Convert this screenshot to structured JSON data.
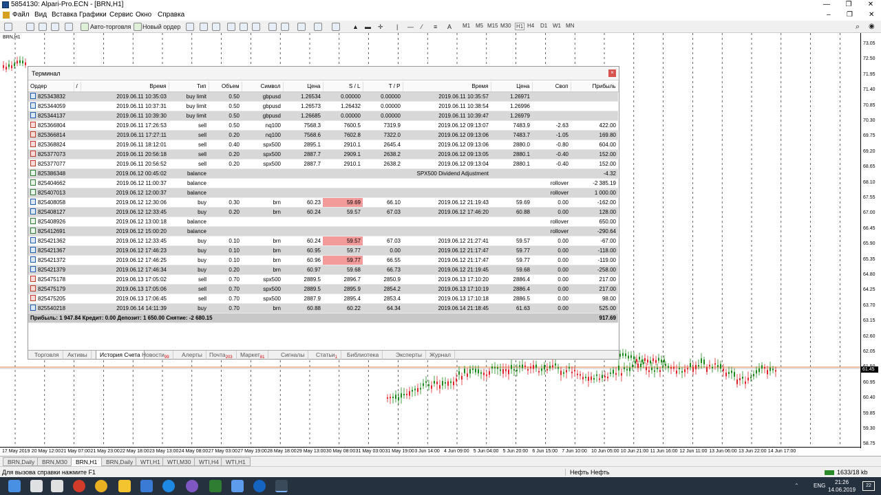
{
  "window": {
    "title": "5854130: Alpari-Pro.ECN - [BRN,H1]"
  },
  "menu": [
    "Файл",
    "Вид",
    "Вставка",
    "Графики",
    "Сервис",
    "Окно",
    "Справка"
  ],
  "toolbar": {
    "auto_trading": "Авто-торговля",
    "new_order": "Новый ордер",
    "timeframes": [
      "M1",
      "M5",
      "M15",
      "M30",
      "H1",
      "H4",
      "D1",
      "W1",
      "MN"
    ]
  },
  "chart": {
    "symbol_label": "BRN,H1",
    "current_price": "61.45",
    "price_labels": [
      "73.05",
      "72.50",
      "71.95",
      "71.40",
      "70.85",
      "70.30",
      "69.75",
      "69.20",
      "68.65",
      "68.10",
      "67.55",
      "67.00",
      "66.45",
      "65.90",
      "65.35",
      "64.80",
      "64.25",
      "63.70",
      "63.15",
      "62.60",
      "62.05",
      "61.50",
      "60.95",
      "60.40",
      "59.85",
      "59.30",
      "58.75"
    ],
    "time_labels": [
      "17 May 2019",
      "20 May 12:00",
      "21 May 07:00",
      "21 May 23:00",
      "22 May 18:00",
      "23 May 13:00",
      "24 May 08:00",
      "27 May 03:00",
      "27 May 19:00",
      "28 May 18:00",
      "29 May 13:00",
      "30 May 08:00",
      "31 May 03:00",
      "31 May 19:00",
      "3 Jun 14:00",
      "4 Jun 09:00",
      "5 Jun 04:00",
      "5 Jun 20:00",
      "6 Jun 15:00",
      "7 Jun 10:00",
      "10 Jun 05:00",
      "10 Jun 21:00",
      "11 Jun 16:00",
      "12 Jun 11:00",
      "13 Jun 06:00",
      "13 Jun 22:00",
      "14 Jun 17:00"
    ]
  },
  "chart_tabs": [
    "BRN,Daily",
    "BRN,M30",
    "BRN,H1",
    "BRN,Daily",
    "WTI,H1",
    "WTI,M30",
    "WTI,H4",
    "WTI,H1"
  ],
  "active_chart_tab": 2,
  "terminal": {
    "title": "Терминал",
    "columns": [
      "Ордер",
      "/",
      "Время",
      "Тип",
      "Объем",
      "Символ",
      "Цена",
      "S / L",
      "T / P",
      "Время",
      "Цена",
      "Своп",
      "Прибыль"
    ],
    "rows": [
      {
        "k": "buy",
        "c": [
          "825343832",
          "2019.06.11 10:35:03",
          "buy limit",
          "0.50",
          "gbpusd",
          "1.26534",
          "0.00000",
          "0.00000",
          "2019.06.11 10:35:57",
          "1.26971",
          "",
          ""
        ]
      },
      {
        "k": "buy",
        "c": [
          "825344059",
          "2019.06.11 10:37:31",
          "buy limit",
          "0.50",
          "gbpusd",
          "1.26573",
          "1.26432",
          "0.00000",
          "2019.06.11 10:38:54",
          "1.26996",
          "",
          ""
        ]
      },
      {
        "k": "buy",
        "c": [
          "825344137",
          "2019.06.11 10:39:30",
          "buy limit",
          "0.50",
          "gbpusd",
          "1.26685",
          "0.00000",
          "0.00000",
          "2019.06.11 10:39:47",
          "1.26979",
          "",
          ""
        ]
      },
      {
        "k": "sell",
        "c": [
          "825366804",
          "2019.06.11 17:26:53",
          "sell",
          "0.50",
          "nq100",
          "7568.3",
          "7600.5",
          "7319.9",
          "2019.06.12 09:13:07",
          "7483.9",
          "-2.63",
          "422.00"
        ]
      },
      {
        "k": "sell",
        "c": [
          "825366814",
          "2019.06.11 17:27:11",
          "sell",
          "0.20",
          "nq100",
          "7568.6",
          "7602.8",
          "7322.0",
          "2019.06.12 09:13:06",
          "7483.7",
          "-1.05",
          "169.80"
        ]
      },
      {
        "k": "sell",
        "c": [
          "825368824",
          "2019.06.11 18:12:01",
          "sell",
          "0.40",
          "spx500",
          "2895.1",
          "2910.1",
          "2645.4",
          "2019.06.12 09:13:06",
          "2880.0",
          "-0.80",
          "604.00"
        ]
      },
      {
        "k": "sell",
        "c": [
          "825377073",
          "2019.06.11 20:56:18",
          "sell",
          "0.20",
          "spx500",
          "2887.7",
          "2909.1",
          "2638.2",
          "2019.06.12 09:13:05",
          "2880.1",
          "-0.40",
          "152.00"
        ]
      },
      {
        "k": "sell",
        "c": [
          "825377077",
          "2019.06.11 20:56:52",
          "sell",
          "0.20",
          "spx500",
          "2887.7",
          "2910.1",
          "2638.2",
          "2019.06.12 09:13:04",
          "2880.1",
          "-0.40",
          "152.00"
        ]
      },
      {
        "k": "bal",
        "c": [
          "825386348",
          "2019.06.12 00:45:02",
          "balance",
          "",
          "",
          "",
          "",
          "",
          "SPX500 Dividend Adjustment",
          "",
          "",
          "-4.32"
        ]
      },
      {
        "k": "bal",
        "c": [
          "825404662",
          "2019.06.12 11:00:37",
          "balance",
          "",
          "",
          "",
          "",
          "",
          "",
          "",
          "rollover",
          "-2 385.19"
        ]
      },
      {
        "k": "bal",
        "c": [
          "825407013",
          "2019.06.12 12:00:37",
          "balance",
          "",
          "",
          "",
          "",
          "",
          "",
          "",
          "rollover",
          "1 000.00"
        ]
      },
      {
        "k": "buy",
        "hl": true,
        "c": [
          "825408058",
          "2019.06.12 12:30:06",
          "buy",
          "0.30",
          "brn",
          "60.23",
          "59.69",
          "66.10",
          "2019.06.12 21:19:43",
          "59.69",
          "0.00",
          "-162.00"
        ]
      },
      {
        "k": "buy",
        "c": [
          "825408127",
          "2019.06.12 12:33:45",
          "buy",
          "0.20",
          "brn",
          "60.24",
          "59.57",
          "67.03",
          "2019.06.12 17:46:20",
          "60.88",
          "0.00",
          "128.00"
        ]
      },
      {
        "k": "bal",
        "c": [
          "825408926",
          "2019.06.12 13:00:18",
          "balance",
          "",
          "",
          "",
          "",
          "",
          "",
          "",
          "rollover",
          "650.00"
        ]
      },
      {
        "k": "bal",
        "c": [
          "825412691",
          "2019.06.12 15:00:20",
          "balance",
          "",
          "",
          "",
          "",
          "",
          "",
          "",
          "rollover",
          "-290.64"
        ]
      },
      {
        "k": "buy",
        "hl": true,
        "c": [
          "825421362",
          "2019.06.12 12:33:45",
          "buy",
          "0.10",
          "brn",
          "60.24",
          "59.57",
          "67.03",
          "2019.06.12 21:27:41",
          "59.57",
          "0.00",
          "-67.00"
        ]
      },
      {
        "k": "buy",
        "hl": true,
        "c": [
          "825421367",
          "2019.06.12 17:46:23",
          "buy",
          "0.10",
          "brn",
          "60.95",
          "59.77",
          "0.00",
          "2019.06.12 21:17:47",
          "59.77",
          "0.00",
          "-118.00"
        ]
      },
      {
        "k": "buy",
        "hl": true,
        "c": [
          "825421372",
          "2019.06.12 17:46:25",
          "buy",
          "0.10",
          "brn",
          "60.96",
          "59.77",
          "66.55",
          "2019.06.12 21:17:47",
          "59.77",
          "0.00",
          "-119.00"
        ]
      },
      {
        "k": "buy",
        "hl": true,
        "c": [
          "825421379",
          "2019.06.12 17:46:34",
          "buy",
          "0.20",
          "brn",
          "60.97",
          "59.68",
          "66.73",
          "2019.06.12 21:19:45",
          "59.68",
          "0.00",
          "-258.00"
        ]
      },
      {
        "k": "sell",
        "c": [
          "825475178",
          "2019.06.13 17:05:02",
          "sell",
          "0.70",
          "spx500",
          "2889.5",
          "2896.7",
          "2850.9",
          "2019.06.13 17:10:20",
          "2886.4",
          "0.00",
          "217.00"
        ]
      },
      {
        "k": "sell",
        "c": [
          "825475179",
          "2019.06.13 17:05:06",
          "sell",
          "0.70",
          "spx500",
          "2889.5",
          "2895.9",
          "2854.2",
          "2019.06.13 17:10:19",
          "2886.4",
          "0.00",
          "217.00"
        ]
      },
      {
        "k": "sell",
        "c": [
          "825475205",
          "2019.06.13 17:06:45",
          "sell",
          "0.70",
          "spx500",
          "2887.9",
          "2895.4",
          "2853.4",
          "2019.06.13 17:10:18",
          "2886.5",
          "0.00",
          "98.00"
        ]
      },
      {
        "k": "buy",
        "c": [
          "825540218",
          "2019.06.14 14:11:39",
          "buy",
          "0.70",
          "brn",
          "60.88",
          "60.22",
          "64.34",
          "2019.06.14 21:18:45",
          "61.63",
          "0.00",
          "525.00"
        ]
      }
    ],
    "summary": {
      "text": "Прибыль: 1 947.84  Кредит: 0.00  Депозит: 1 650.00  Снятие: -2 680.15",
      "total": "917.69"
    },
    "tabs": [
      {
        "label": "Торговля"
      },
      {
        "label": "Активы"
      },
      {
        "label": "История Счета",
        "active": true
      },
      {
        "label": "Новости",
        "badge": "99"
      },
      {
        "label": "Алерты"
      },
      {
        "label": "Почта",
        "badge": "203"
      },
      {
        "label": "Маркет",
        "badge": "81"
      },
      {
        "label": "Сигналы"
      },
      {
        "label": "Статьи",
        "badge": "1"
      },
      {
        "label": "Библиотека"
      },
      {
        "label": "Эксперты"
      },
      {
        "label": "Журнал"
      }
    ]
  },
  "status": {
    "help": "Для вызова справки нажмите F1",
    "profile": "Нефть Нефть",
    "traffic": "1633/18 kb"
  },
  "taskbar": {
    "lang": "ENG",
    "time": "21:26",
    "date": "14.06.2019",
    "notif": "22"
  },
  "colors": {
    "bull": "#1a8a1a",
    "bear": "#e0202a",
    "highlight": "#f39a9a",
    "summary_bg": "#c8c8c8"
  }
}
